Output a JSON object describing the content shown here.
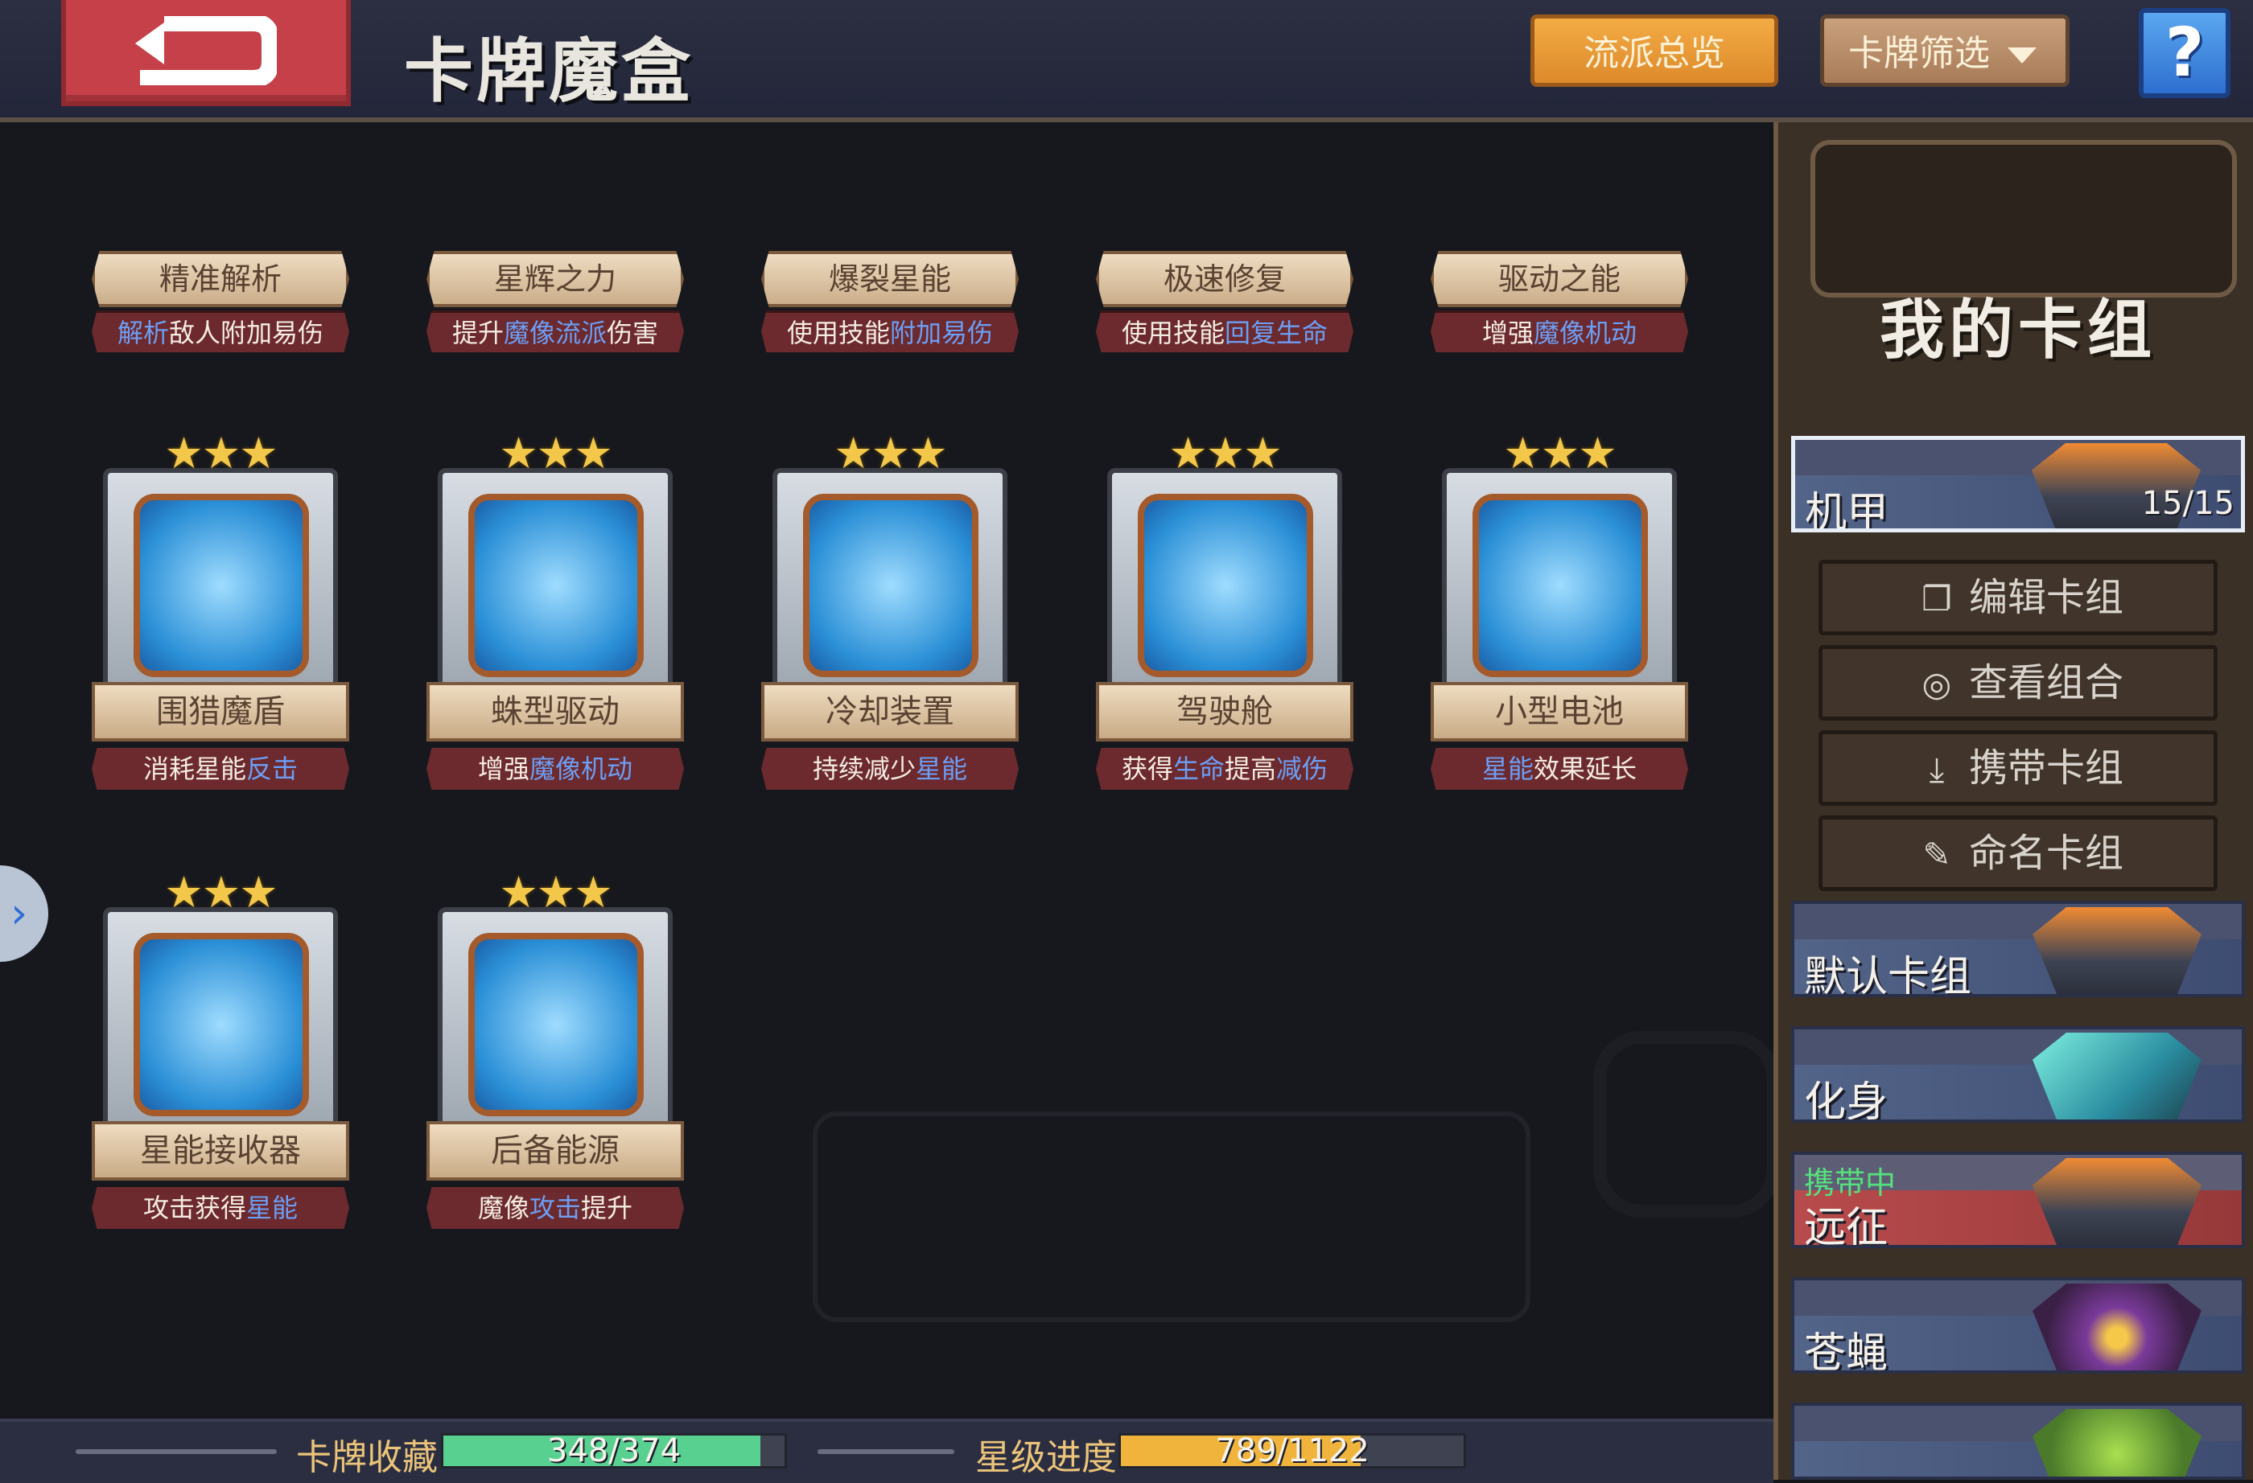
{
  "header": {
    "title": "卡牌魔盒",
    "genre_overview": "流派总览",
    "card_filter": "卡牌筛选",
    "help": "?"
  },
  "top_skills": [
    {
      "name": "精准解析",
      "desc_a": "解析",
      "desc_b": "敌人附加易伤",
      "desc_c": ""
    },
    {
      "name": "星辉之力",
      "desc_a": "提升",
      "desc_b": "魔像流派",
      "desc_c": "伤害"
    },
    {
      "name": "爆裂星能",
      "desc_a": "使用技能",
      "desc_b": "附加易伤",
      "desc_c": ""
    },
    {
      "name": "极速修复",
      "desc_a": "使用技能",
      "desc_b": "回复生命",
      "desc_c": ""
    },
    {
      "name": "驱动之能",
      "desc_a": "增强",
      "desc_b": "魔像机动",
      "desc_c": ""
    }
  ],
  "cards": [
    {
      "name": "围猎魔盾",
      "desc_a": "消耗星能",
      "desc_b": "反击",
      "stars": "★★★"
    },
    {
      "name": "蛛型驱动",
      "desc_a": "增强",
      "desc_b": "魔像机动",
      "stars": "★★★"
    },
    {
      "name": "冷却装置",
      "desc_a": "持续减少",
      "desc_b": "星能",
      "stars": "★★★"
    },
    {
      "name": "驾驶舱",
      "desc_a": "获得",
      "desc_b": "生命",
      "desc_c": "提高",
      "desc_d": "减伤",
      "stars": "★★★"
    },
    {
      "name": "小型电池",
      "desc_a": "星能",
      "desc_b": "效果延长",
      "stars": "★★★"
    },
    {
      "name": "星能接收器",
      "desc_a": "攻击获得",
      "desc_b": "星能",
      "stars": "★★★"
    },
    {
      "name": "后备能源",
      "desc_a": "魔像",
      "desc_b": "攻击",
      "desc_c": "提升",
      "stars": "★★★"
    }
  ],
  "panel": {
    "title": "我的卡组",
    "active_deck": {
      "name": "机甲",
      "count": "15/15"
    },
    "actions": [
      {
        "label": "编辑卡组",
        "icon": "copy-icon"
      },
      {
        "label": "查看组合",
        "icon": "eye-icon"
      },
      {
        "label": "携带卡组",
        "icon": "download-icon"
      },
      {
        "label": "命名卡组",
        "icon": "pencil-icon"
      }
    ],
    "decks": [
      {
        "name": "默认卡组"
      },
      {
        "name": "化身"
      },
      {
        "name": "远征",
        "status": "携带中"
      },
      {
        "name": "苍蝇"
      }
    ]
  },
  "footer": {
    "collection_label": "卡牌收藏",
    "collection_value": "348/374",
    "collection_fraction": 0.93,
    "star_label": "星级进度",
    "star_value": "789/1122",
    "star_fraction": 0.7
  },
  "colors": {
    "accent_blue_text": "#6d9ef5",
    "progress_green": "#58d190",
    "progress_gold": "#f0b43c",
    "carry_green": "#56e07c"
  }
}
